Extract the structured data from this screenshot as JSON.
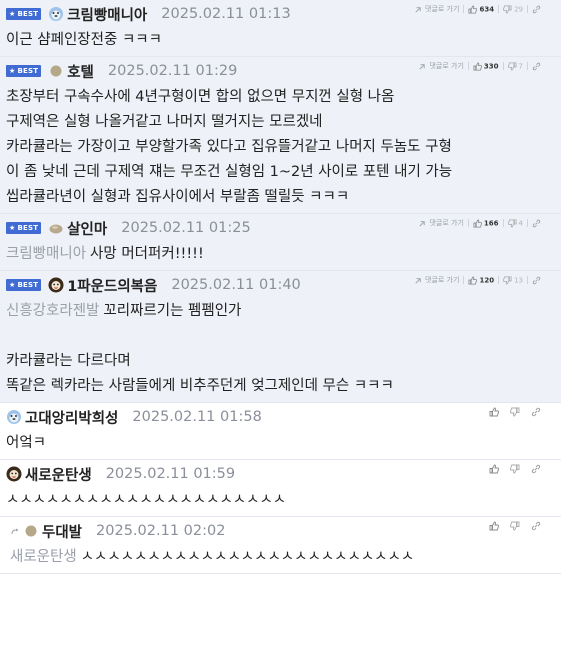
{
  "comments": [
    {
      "type": "best",
      "badge": "BEST",
      "author": "크림빵매니아",
      "avatar_icon": "bear-face-icon",
      "date": "2025.02.11 01:13",
      "reply_label": "댓글로 가기",
      "likes": "634",
      "dislikes": "29",
      "lines": [
        "이근 샴페인장전중 ㅋㅋㅋ"
      ]
    },
    {
      "type": "best",
      "badge": "BEST",
      "author": "호텔",
      "avatar_icon": "dot-icon",
      "date": "2025.02.11 01:29",
      "reply_label": "댓글로 가기",
      "likes": "330",
      "dislikes": "7",
      "lines": [
        "초장부터 구속수사에 4년구형이면 합의 없으면 무지껀 실형 나옴",
        "구제역은 실형 나올거같고 나머지 떨거지는 모르겠네",
        "카라큘라는 가장이고 부양할가족 있다고 집유뜰거같고 나머지 두놈도 구형",
        "이 좀 낮네 근데 구제역 쟤는 무조건 실형임 1~2년 사이로 포텐 내기 가능",
        "씹라큘라년이 실형과 집유사이에서 부랄좀 떨릴듯 ㅋㅋㅋ"
      ]
    },
    {
      "type": "best",
      "badge": "BEST",
      "author": "살인마",
      "avatar_icon": "stone-icon",
      "date": "2025.02.11 01:25",
      "reply_label": "댓글로 가기",
      "likes": "166",
      "dislikes": "4",
      "mention": "크림빵매니아",
      "lines": [
        "사망 머더퍼커!!!!!"
      ]
    },
    {
      "type": "best",
      "badge": "BEST",
      "author": "1파운드의복음",
      "avatar_icon": "lion-icon",
      "date": "2025.02.11 01:40",
      "reply_label": "댓글로 가기",
      "likes": "120",
      "dislikes": "13",
      "mention": "신흥강호라젠발",
      "lines": [
        "꼬리짜르기는 펨펨인가",
        "",
        "카라큘라는 다르다며",
        "똑같은 렉카라는 사람들에게 비추주던게 엊그제인데 무슨 ㅋㅋㅋ"
      ]
    },
    {
      "type": "plain",
      "author": "고대앙리박희성",
      "avatar_icon": "bear-face-icon",
      "date": "2025.02.11 01:58",
      "lines": [
        "어엌ㅋ"
      ]
    },
    {
      "type": "plain",
      "author": "새로운탄생",
      "avatar_icon": "lion-icon",
      "date": "2025.02.11 01:59",
      "lines": [
        "ㅅㅅㅅㅅㅅㅅㅅㅅㅅㅅㅅㅅㅅㅅㅅㅅㅅㅅㅅㅅㅅ"
      ]
    },
    {
      "type": "plain",
      "child": true,
      "author": "두대발",
      "avatar_icon": "dot-icon",
      "date": "2025.02.11 02:02",
      "mention": "새로운탄생",
      "lines": [
        "ㅅㅅㅅㅅㅅㅅㅅㅅㅅㅅㅅㅅㅅㅅㅅㅅㅅㅅㅅㅅㅅㅅㅅㅅㅅ"
      ]
    }
  ],
  "colors": {
    "best_bg": "#eef1f7",
    "badge": "#3f6bd3",
    "date": "#8a8f99",
    "mention": "#9aa0aa"
  }
}
